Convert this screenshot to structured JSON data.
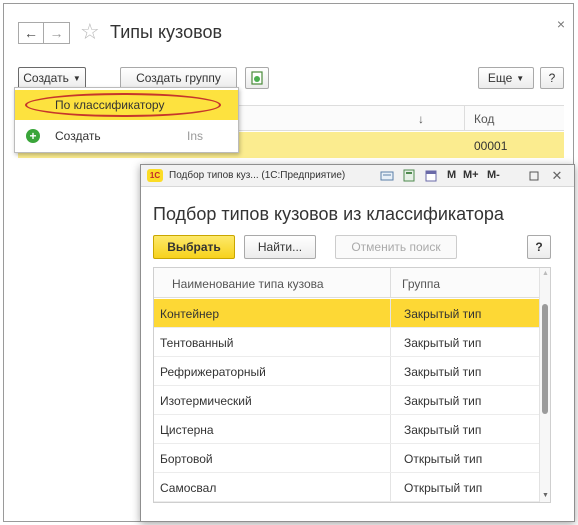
{
  "window": {
    "title": "Типы кузовов",
    "back_icon": "arrow-left",
    "forward_icon": "arrow-right",
    "favorite_icon": "star-outline",
    "close_label": "×"
  },
  "toolbar": {
    "create_label": "Создать",
    "create_group_label": "Создать группу",
    "more_label": "Еще",
    "help_label": "?"
  },
  "bg_table": {
    "sort_indicator": "↓",
    "code_header": "Код",
    "rows": [
      {
        "code": "00001"
      }
    ]
  },
  "dropdown": {
    "items": [
      {
        "label": "По классификатору",
        "highlighted": true
      },
      {
        "label": "Создать",
        "shortcut": "Ins",
        "icon": "plus-circle"
      }
    ]
  },
  "modal": {
    "window_title": "Подбор типов куз... (1С:Предприятие)",
    "toolbar_text": {
      "m": "M",
      "m_plus": "M+",
      "m_minus": "M-"
    },
    "title": "Подбор типов кузовов из классификатора",
    "buttons": {
      "select": "Выбрать",
      "find": "Найти...",
      "cancel_search": "Отменить поиск",
      "help": "?"
    },
    "columns": [
      "Наименование типа кузова",
      "Группа"
    ],
    "rows": [
      {
        "name": "Контейнер",
        "group": "Закрытый тип",
        "selected": true
      },
      {
        "name": "Тентованный",
        "group": "Закрытый тип"
      },
      {
        "name": "Рефрижераторный",
        "group": "Закрытый тип"
      },
      {
        "name": "Изотермический",
        "group": "Закрытый тип"
      },
      {
        "name": "Цистерна",
        "group": "Закрытый тип"
      },
      {
        "name": "Бортовой",
        "group": "Открытый тип"
      },
      {
        "name": "Самосвал",
        "group": "Открытый тип"
      }
    ]
  },
  "colors": {
    "accent_yellow": "#fdd835",
    "highlight_red": "#c6362b",
    "selected_row_bg": "#fbec8f"
  }
}
